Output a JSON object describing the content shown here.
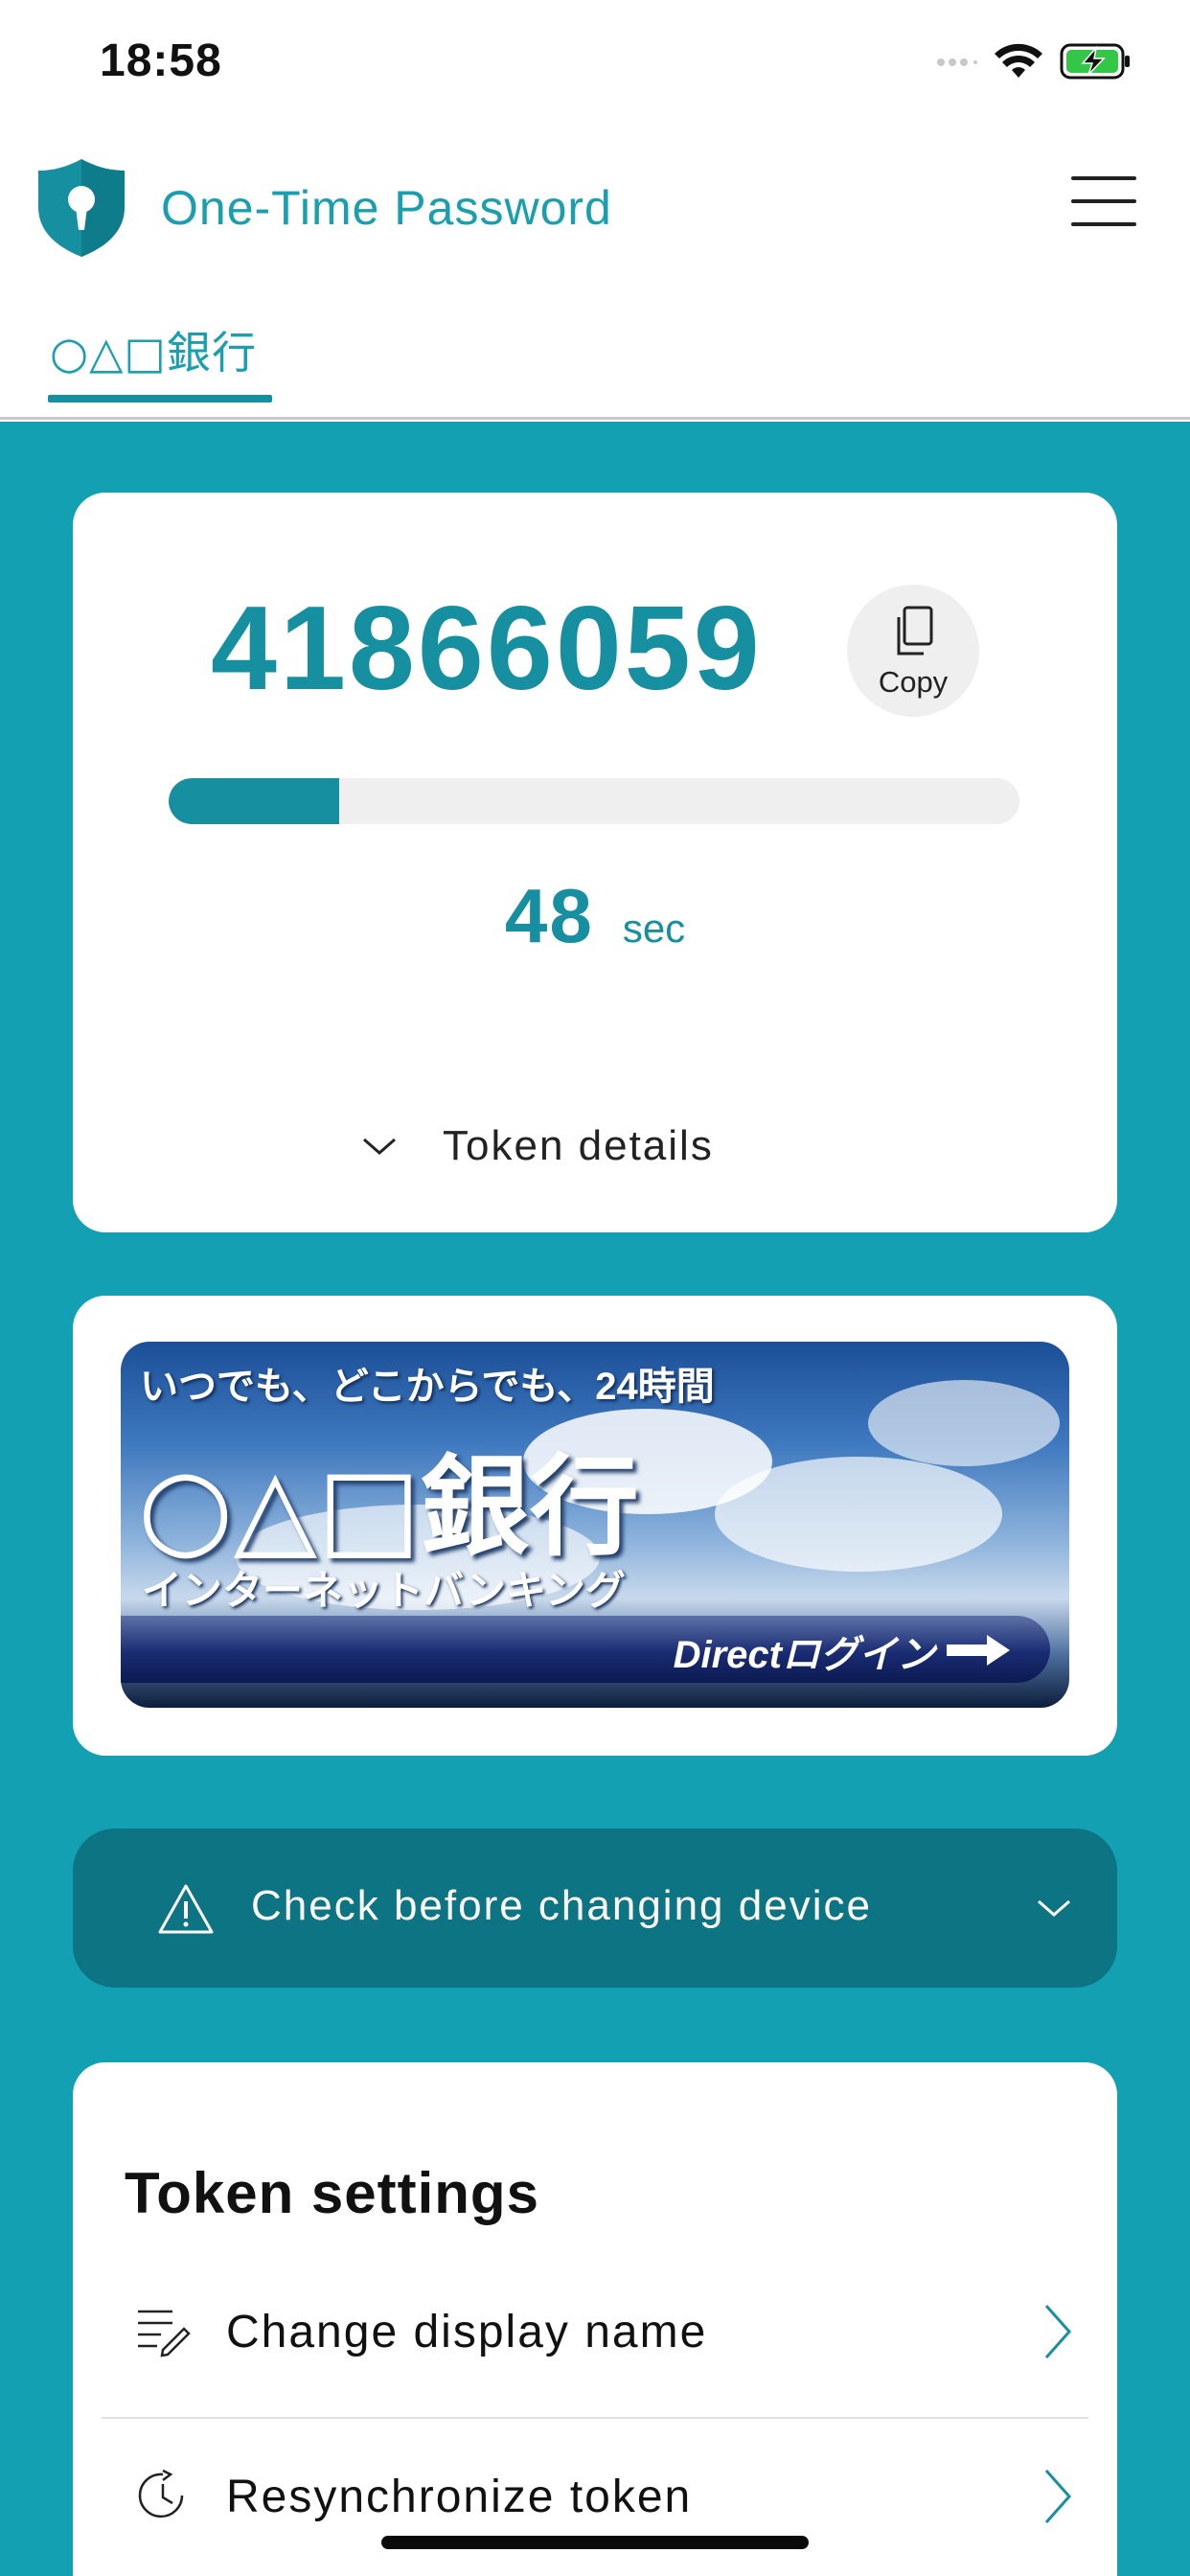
{
  "status_bar": {
    "time": "18:58"
  },
  "header": {
    "title": "One-Time Password",
    "accent_color": "#1a9fae"
  },
  "tabs": [
    {
      "label": "○△□銀行",
      "selected": true
    }
  ],
  "token": {
    "code": "41866059",
    "copy_label": "Copy",
    "remaining_seconds": "48",
    "seconds_unit": "sec",
    "progress_fraction": 0.2,
    "details_label": "Token details"
  },
  "banner": {
    "tagline": "いつでも、どこからでも、24時間",
    "bank_name": "○△□銀行",
    "subtitle": "インターネットバンキング",
    "login_label": "Directログイン"
  },
  "warning": {
    "label": "Check before changing device"
  },
  "settings": {
    "title": "Token settings",
    "items": [
      {
        "label": "Change display name",
        "icon": "edit-list-icon"
      },
      {
        "label": "Resynchronize token",
        "icon": "resync-clock-icon"
      }
    ]
  },
  "colors": {
    "brand": "#168fa0",
    "background": "#13a0b2",
    "warning_bg": "#0c7482"
  }
}
